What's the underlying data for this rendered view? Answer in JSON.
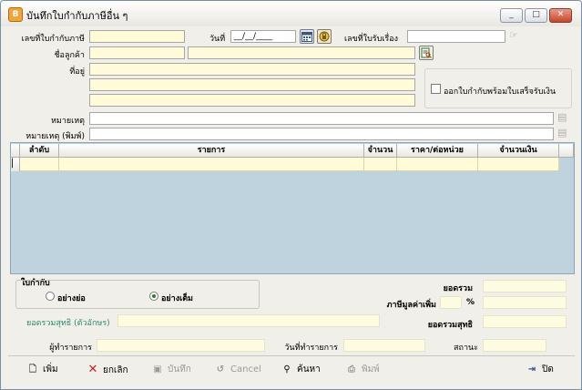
{
  "window": {
    "title": "บันทึกใบกำกับภาษีอื่น ๆ",
    "icon_text": "B",
    "minimize": "_",
    "maximize": "□",
    "close": "✕"
  },
  "header": {
    "tax_invoice_no_label": "เลขที่ใบกำกับภาษี",
    "date_label": "วันที่",
    "date_value": "__/__/____",
    "receipt_no_label": "เลขที่ใบรับเรื่อง",
    "customer_name_label": "ชื่อลูกค้า",
    "address_label": "ที่อยู่",
    "issue_with_receipt_label": "ออกใบกำกับพร้อมใบเสร็จรับเงิน",
    "remark_label": "หมายเหตุ",
    "remark_print_label": "หมายเหตุ (พิมพ์)"
  },
  "grid": {
    "columns": [
      "ลำดับ",
      "รายการ",
      "จำนวน",
      "ราคา/ต่อหน่วย",
      "จำนวนเงิน"
    ]
  },
  "footer": {
    "invoice_type_label": "ใบกำกับ",
    "option_short": "อย่างย่อ",
    "option_full": "อย่างเต็ม",
    "selected_option": "full",
    "total_text_label": "ยอดรวมสุทธิ (ตัวอักษร)",
    "total_label": "ยอดรวม",
    "vat_label": "ภาษีมูลค่าเพิ่ม",
    "percent_sign": "%",
    "net_total_label": "ยอดรวมสุทธิ",
    "created_by_label": "ผู้ทำรายการ",
    "created_date_label": "วันที่ทำรายการ",
    "status_label": "สถานะ"
  },
  "toolbar": {
    "add": "เพิ่ม",
    "cancel_void": "ยกเลิก",
    "save": "บันทึก",
    "cancel": "Cancel",
    "search": "ค้นหา",
    "print": "พิมพ์",
    "close": "ปิด"
  }
}
